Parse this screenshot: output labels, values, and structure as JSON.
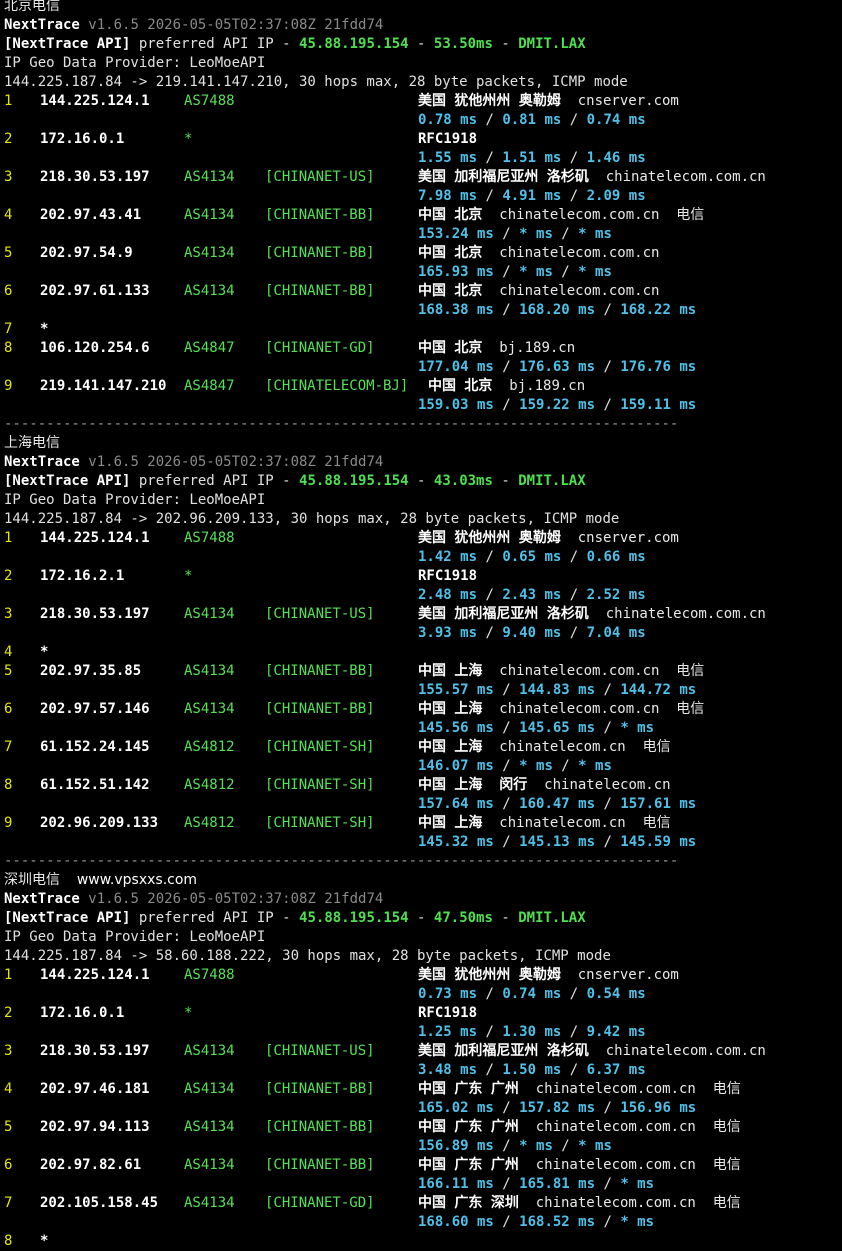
{
  "sections": [
    {
      "location": "北京电信",
      "site": "",
      "version_name": "NextTrace",
      "version_info": "v1.6.5 2026-05-05T02:37:08Z 21fdd74",
      "api_tag": "[NextTrace API]",
      "api_text": "preferred API IP - ",
      "api_ip": "45.88.195.154",
      "api_latency": "53.50ms",
      "api_node": "DMIT.LAX",
      "geo_provider": "IP Geo Data Provider: LeoMoeAPI",
      "route": "144.225.187.84 -> 219.141.147.210, 30 hops max, 28 byte packets, ICMP mode",
      "hops": [
        {
          "n": "1",
          "ip": "144.225.124.1",
          "as": "AS7488",
          "net": "",
          "geo": "美国 犹他州州 奥勒姆",
          "host": "cnserver.com",
          "rtt": [
            "0.78 ms",
            "0.81 ms",
            "0.74 ms"
          ]
        },
        {
          "n": "2",
          "ip": "172.16.0.1",
          "as": "*",
          "net": "",
          "geo": "RFC1918",
          "host": "",
          "rtt": [
            "1.55 ms",
            "1.51 ms",
            "1.46 ms"
          ]
        },
        {
          "n": "3",
          "ip": "218.30.53.197",
          "as": "AS4134",
          "net": "[CHINANET-US]",
          "geo": "美国 加利福尼亚州 洛杉矶",
          "host": "chinatelecom.com.cn",
          "rtt": [
            "7.98 ms",
            "4.91 ms",
            "2.09 ms"
          ]
        },
        {
          "n": "4",
          "ip": "202.97.43.41",
          "as": "AS4134",
          "net": "[CHINANET-BB]",
          "geo": "中国 北京",
          "host": "chinatelecom.com.cn  电信",
          "rtt": [
            "153.24 ms",
            "* ms",
            "* ms"
          ]
        },
        {
          "n": "5",
          "ip": "202.97.54.9",
          "as": "AS4134",
          "net": "[CHINANET-BB]",
          "geo": "中国 北京",
          "host": "chinatelecom.com.cn",
          "rtt": [
            "165.93 ms",
            "* ms",
            "* ms"
          ]
        },
        {
          "n": "6",
          "ip": "202.97.61.133",
          "as": "AS4134",
          "net": "[CHINANET-BB]",
          "geo": "中国 北京",
          "host": "chinatelecom.com.cn",
          "rtt": [
            "168.38 ms",
            "168.20 ms",
            "168.22 ms"
          ]
        },
        {
          "n": "7",
          "ip": "*",
          "as": "",
          "net": "",
          "geo": "",
          "host": "",
          "rtt": []
        },
        {
          "n": "8",
          "ip": "106.120.254.6",
          "as": "AS4847",
          "net": "[CHINANET-GD]",
          "geo": "中国 北京",
          "host": "bj.189.cn",
          "rtt": [
            "177.04 ms",
            "176.63 ms",
            "176.76 ms"
          ]
        },
        {
          "n": "9",
          "ip": "219.141.147.210",
          "as": "AS4847",
          "net": "[CHINATELECOM-BJ]",
          "geo": "中国 北京",
          "host": "bj.189.cn",
          "rtt": [
            "159.03 ms",
            "159.22 ms",
            "159.11 ms"
          ]
        }
      ]
    },
    {
      "location": "上海电信",
      "site": "",
      "version_name": "NextTrace",
      "version_info": "v1.6.5 2026-05-05T02:37:08Z 21fdd74",
      "api_tag": "[NextTrace API]",
      "api_text": "preferred API IP - ",
      "api_ip": "45.88.195.154",
      "api_latency": "43.03ms",
      "api_node": "DMIT.LAX",
      "geo_provider": "IP Geo Data Provider: LeoMoeAPI",
      "route": "144.225.187.84 -> 202.96.209.133, 30 hops max, 28 byte packets, ICMP mode",
      "hops": [
        {
          "n": "1",
          "ip": "144.225.124.1",
          "as": "AS7488",
          "net": "",
          "geo": "美国 犹他州州 奥勒姆",
          "host": "cnserver.com",
          "rtt": [
            "1.42 ms",
            "0.65 ms",
            "0.66 ms"
          ]
        },
        {
          "n": "2",
          "ip": "172.16.2.1",
          "as": "*",
          "net": "",
          "geo": "RFC1918",
          "host": "",
          "rtt": [
            "2.48 ms",
            "2.43 ms",
            "2.52 ms"
          ]
        },
        {
          "n": "3",
          "ip": "218.30.53.197",
          "as": "AS4134",
          "net": "[CHINANET-US]",
          "geo": "美国 加利福尼亚州 洛杉矶",
          "host": "chinatelecom.com.cn",
          "rtt": [
            "3.93 ms",
            "9.40 ms",
            "7.04 ms"
          ]
        },
        {
          "n": "4",
          "ip": "*",
          "as": "",
          "net": "",
          "geo": "",
          "host": "",
          "rtt": []
        },
        {
          "n": "5",
          "ip": "202.97.35.85",
          "as": "AS4134",
          "net": "[CHINANET-BB]",
          "geo": "中国 上海",
          "host": "chinatelecom.com.cn  电信",
          "rtt": [
            "155.57 ms",
            "144.83 ms",
            "144.72 ms"
          ]
        },
        {
          "n": "6",
          "ip": "202.97.57.146",
          "as": "AS4134",
          "net": "[CHINANET-BB]",
          "geo": "中国 上海",
          "host": "chinatelecom.com.cn  电信",
          "rtt": [
            "145.56 ms",
            "145.65 ms",
            "* ms"
          ]
        },
        {
          "n": "7",
          "ip": "61.152.24.145",
          "as": "AS4812",
          "net": "[CHINANET-SH]",
          "geo": "中国 上海",
          "host": "chinatelecom.cn  电信",
          "rtt": [
            "146.07 ms",
            "* ms",
            "* ms"
          ]
        },
        {
          "n": "8",
          "ip": "61.152.51.142",
          "as": "AS4812",
          "net": "[CHINANET-SH]",
          "geo": "中国 上海  闵行",
          "host": "chinatelecom.cn",
          "rtt": [
            "157.64 ms",
            "160.47 ms",
            "157.61 ms"
          ]
        },
        {
          "n": "9",
          "ip": "202.96.209.133",
          "as": "AS4812",
          "net": "[CHINANET-SH]",
          "geo": "中国 上海",
          "host": "chinatelecom.cn  电信",
          "rtt": [
            "145.32 ms",
            "145.13 ms",
            "145.59 ms"
          ]
        }
      ]
    },
    {
      "location": "深圳电信",
      "site": "www.vpsxxs.com",
      "version_name": "NextTrace",
      "version_info": "v1.6.5 2026-05-05T02:37:08Z 21fdd74",
      "api_tag": "[NextTrace API]",
      "api_text": "preferred API IP - ",
      "api_ip": "45.88.195.154",
      "api_latency": "47.50ms",
      "api_node": "DMIT.LAX",
      "geo_provider": "IP Geo Data Provider: LeoMoeAPI",
      "route": "144.225.187.84 -> 58.60.188.222, 30 hops max, 28 byte packets, ICMP mode",
      "hops": [
        {
          "n": "1",
          "ip": "144.225.124.1",
          "as": "AS7488",
          "net": "",
          "geo": "美国 犹他州州 奥勒姆",
          "host": "cnserver.com",
          "rtt": [
            "0.73 ms",
            "0.74 ms",
            "0.54 ms"
          ]
        },
        {
          "n": "2",
          "ip": "172.16.0.1",
          "as": "*",
          "net": "",
          "geo": "RFC1918",
          "host": "",
          "rtt": [
            "1.25 ms",
            "1.30 ms",
            "9.42 ms"
          ]
        },
        {
          "n": "3",
          "ip": "218.30.53.197",
          "as": "AS4134",
          "net": "[CHINANET-US]",
          "geo": "美国 加利福尼亚州 洛杉矶",
          "host": "chinatelecom.com.cn",
          "rtt": [
            "3.48 ms",
            "1.50 ms",
            "6.37 ms"
          ]
        },
        {
          "n": "4",
          "ip": "202.97.46.181",
          "as": "AS4134",
          "net": "[CHINANET-BB]",
          "geo": "中国 广东 广州",
          "host": "chinatelecom.com.cn  电信",
          "rtt": [
            "165.02 ms",
            "157.82 ms",
            "156.96 ms"
          ]
        },
        {
          "n": "5",
          "ip": "202.97.94.113",
          "as": "AS4134",
          "net": "[CHINANET-BB]",
          "geo": "中国 广东 广州",
          "host": "chinatelecom.com.cn  电信",
          "rtt": [
            "156.89 ms",
            "* ms",
            "* ms"
          ]
        },
        {
          "n": "6",
          "ip": "202.97.82.61",
          "as": "AS4134",
          "net": "[CHINANET-BB]",
          "geo": "中国 广东 广州",
          "host": "chinatelecom.com.cn  电信",
          "rtt": [
            "166.11 ms",
            "165.81 ms",
            "* ms"
          ]
        },
        {
          "n": "7",
          "ip": "202.105.158.45",
          "as": "AS4134",
          "net": "[CHINANET-GD]",
          "geo": "中国 广东 深圳",
          "host": "chinatelecom.com.cn  电信",
          "rtt": [
            "168.60 ms",
            "168.52 ms",
            "* ms"
          ]
        },
        {
          "n": "8",
          "ip": "*",
          "as": "",
          "net": "",
          "geo": "",
          "host": "",
          "rtt": []
        }
      ]
    }
  ],
  "separator": "--------------------------------------------------------------------------------",
  "colors": {
    "background": "#000000",
    "hop": "#e6e600",
    "asn": "#55e055",
    "rtt": "#4fc1e9",
    "api_green": "#4ee04e"
  }
}
